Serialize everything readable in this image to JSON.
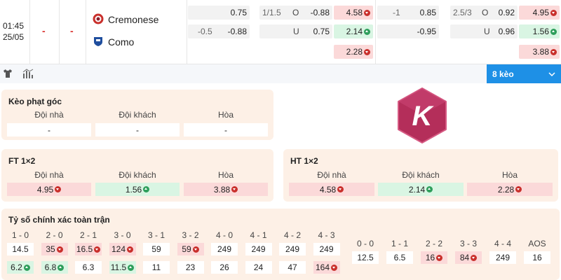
{
  "match": {
    "time": "01:45",
    "date": "25/05",
    "home_team": "Cremonese",
    "away_team": "Como",
    "dash1": "-",
    "dash2": "-"
  },
  "odds": {
    "c1": [
      "0.75",
      "-0.88",
      ""
    ],
    "c1_hcp": [
      "",
      "-0.5",
      ""
    ],
    "c2_line": [
      "1/1.5",
      "",
      ""
    ],
    "c2_label": [
      "O",
      "U",
      ""
    ],
    "c2": [
      "-0.88",
      "0.75",
      ""
    ],
    "c3": [
      "4.58",
      "2.14",
      "2.28"
    ],
    "c4_hcp": [
      "-1",
      "",
      ""
    ],
    "c4": [
      "0.85",
      "-0.95",
      ""
    ],
    "c5_line": [
      "2.5/3",
      "",
      ""
    ],
    "c5_label": [
      "O",
      "U",
      ""
    ],
    "c5": [
      "0.92",
      "0.96",
      ""
    ],
    "c6": [
      "4.95",
      "1.56",
      "3.88"
    ]
  },
  "colors": {
    "red_bg": "#fbd9d9",
    "green_bg": "#d9f5e3",
    "accent": "#1e90e6",
    "panel": "#fdf0e6",
    "logo": "#b42e5a"
  },
  "toolbar": {
    "shirt_icon": "shirt-icon",
    "stats_icon": "stats-icon",
    "tab_label": "8 kèo",
    "tab_chevron": "chevron-down-icon"
  },
  "corner": {
    "title": "Kèo phạt góc",
    "headers": [
      "Đội nhà",
      "Đội khách",
      "Hòa"
    ],
    "values": [
      "-",
      "-",
      "-"
    ]
  },
  "ft": {
    "title": "FT 1×2",
    "headers": [
      "Đội nhà",
      "Đội khách",
      "Hòa"
    ],
    "values": [
      "4.95",
      "1.56",
      "3.88"
    ]
  },
  "ht": {
    "title": "HT 1×2",
    "headers": [
      "Đội nhà",
      "Đội khách",
      "Hòa"
    ],
    "values": [
      "4.58",
      "2.14",
      "2.28"
    ]
  },
  "logo": {
    "letter": "K"
  },
  "score": {
    "title": "Tỷ số chính xác toàn trận",
    "left_headers": [
      "1 - 0",
      "2 - 0",
      "2 - 1",
      "3 - 0",
      "3 - 1",
      "3 - 2",
      "4 - 0",
      "4 - 1",
      "4 - 2",
      "4 - 3"
    ],
    "left_row1": [
      "14.5",
      "35",
      "16.5",
      "124",
      "59",
      "59",
      "249",
      "249",
      "249",
      "249"
    ],
    "left_row2": [
      "6.2",
      "6.8",
      "6.3",
      "11.5",
      "11",
      "23",
      "26",
      "24",
      "47",
      "164"
    ],
    "right_headers": [
      "0 - 0",
      "1 - 1",
      "2 - 2",
      "3 - 3",
      "4 - 4",
      "AOS"
    ],
    "right_row": [
      "12.5",
      "6.5",
      "16",
      "84",
      "249",
      "16"
    ]
  }
}
